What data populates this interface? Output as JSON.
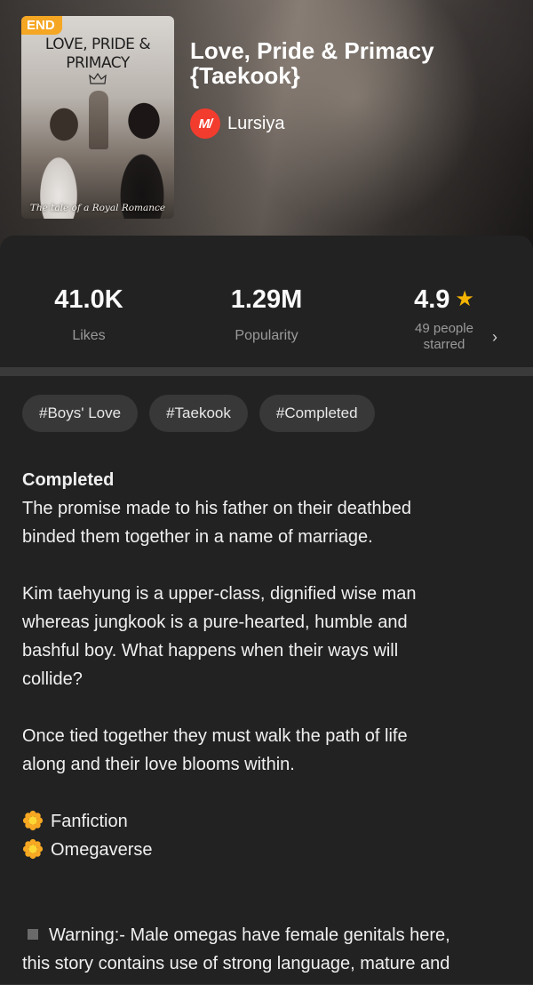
{
  "book": {
    "title": "Love, Pride & Primacy {Taekook}",
    "author": "Lursiya",
    "author_logo_text": "M/",
    "cover": {
      "badge": "END",
      "title_line1": "LOVE, PRIDE &",
      "title_line2": "PRIMACY",
      "tagline": "The tale of a Royal Romance"
    }
  },
  "stats": {
    "likes_value": "41.0K",
    "likes_label": "Likes",
    "popularity_value": "1.29M",
    "popularity_label": "Popularity",
    "rating_value": "4.9",
    "rating_label_line1": "49 people",
    "rating_label_line2": "starred"
  },
  "tags": [
    "#Boys' Love",
    "#Taekook",
    "#Completed"
  ],
  "description": {
    "status": "Completed",
    "lines": [
      "The promise made to his father on their deathbed",
      "binded them together in a name of marriage.",
      "",
      "Kim taehyung is a upper-class, dignified wise man",
      "whereas jungkook is a pure-hearted, humble and",
      "bashful boy. What happens when their ways will",
      "collide?",
      "",
      "Once tied together they must walk the path of life",
      "along and their love blooms within."
    ],
    "genres": [
      "Fanfiction",
      "Omegaverse"
    ],
    "warning_line1": "Warning:- Male omegas have female genitals here,",
    "warning_line2": "this story contains use of strong language, mature and"
  },
  "colors": {
    "background": "#222222",
    "accent_star": "#f5b400",
    "end_badge": "#f5a623",
    "author_logo": "#f23c2e",
    "tag_bg": "#383838"
  }
}
